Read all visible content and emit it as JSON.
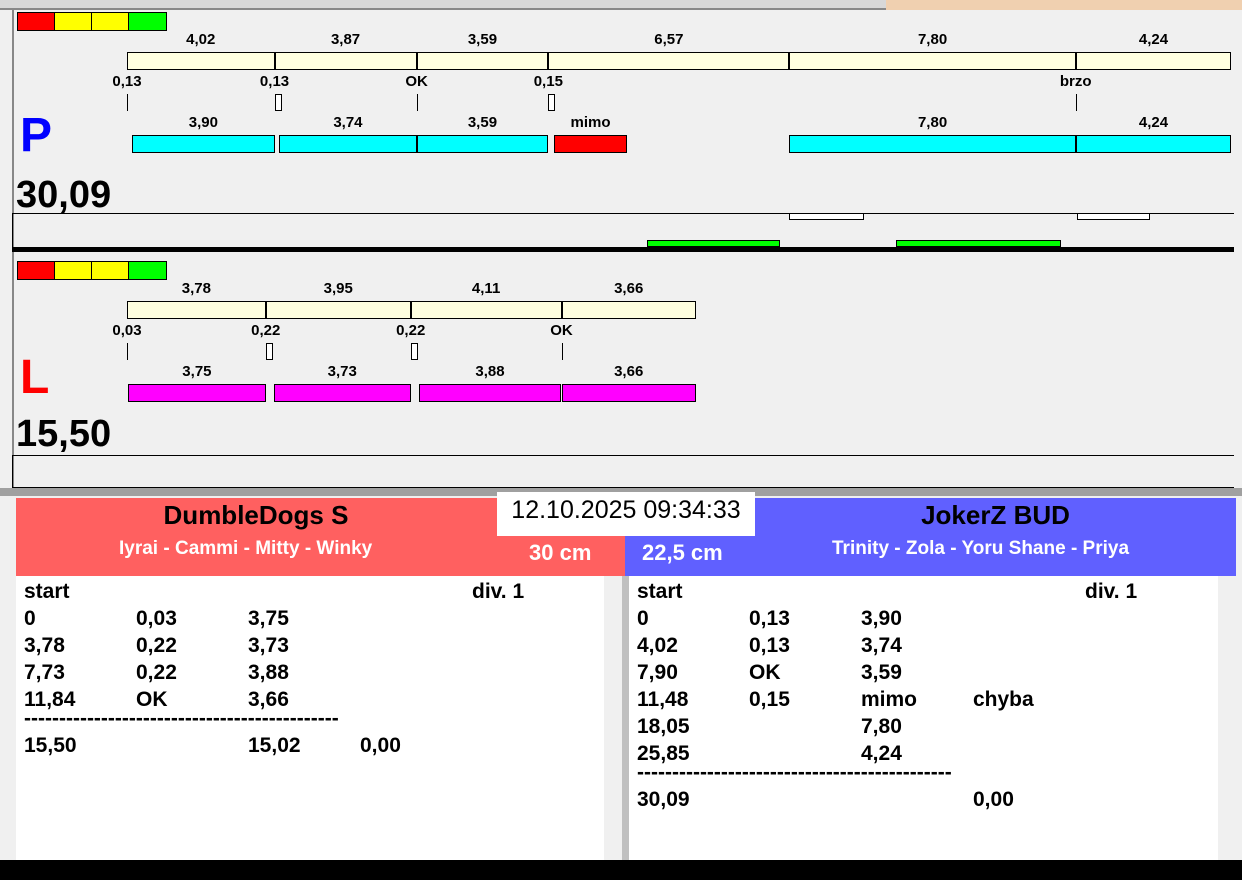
{
  "colors": {
    "legend": [
      "#ff0000",
      "#ffff00",
      "#ffff00",
      "#00ff00"
    ],
    "top_bar": "#ffffe0",
    "p_run": "#00ffff",
    "l_run": "#ff00ff",
    "miss": "#ff0000",
    "left_team": "#ff6060",
    "right_team": "#6060ff",
    "green": "#00ff00"
  },
  "p": {
    "letter": "P",
    "total": "30,09",
    "splits": [
      {
        "label": "4,02",
        "v": 4.02
      },
      {
        "label": "3,87",
        "v": 3.87
      },
      {
        "label": "3,59",
        "v": 3.59
      },
      {
        "label": "6,57",
        "v": 6.57
      },
      {
        "label": "7,80",
        "v": 7.8
      },
      {
        "label": "4,24",
        "v": 4.24
      }
    ],
    "reactions": [
      "0,13",
      "0,13",
      "OK",
      "0,15",
      "",
      "brzo"
    ],
    "runs": [
      {
        "label": "3,90",
        "start": 0.13,
        "v": 3.9,
        "type": "run"
      },
      {
        "label": "3,74",
        "start": 4.15,
        "v": 3.74,
        "type": "run"
      },
      {
        "label": "3,59",
        "start": 7.89,
        "v": 3.59,
        "type": "run"
      },
      {
        "label": "mimo",
        "start": 11.63,
        "v": 2.0,
        "type": "miss"
      },
      {
        "label": "7,80",
        "start": 18.05,
        "v": 7.8,
        "type": "run"
      },
      {
        "label": "4,24",
        "start": 25.85,
        "v": 4.24,
        "type": "run"
      }
    ]
  },
  "l": {
    "letter": "L",
    "total": "15,50",
    "splits": [
      {
        "label": "3,78",
        "v": 3.78
      },
      {
        "label": "3,95",
        "v": 3.95
      },
      {
        "label": "4,11",
        "v": 4.11
      },
      {
        "label": "3,66",
        "v": 3.66
      }
    ],
    "reactions": [
      "0,03",
      "0,22",
      "0,22",
      "OK"
    ],
    "runs": [
      {
        "label": "3,75",
        "start": 0.03,
        "v": 3.75,
        "type": "run"
      },
      {
        "label": "3,73",
        "start": 4.0,
        "v": 3.73,
        "type": "run"
      },
      {
        "label": "3,88",
        "start": 7.95,
        "v": 3.88,
        "type": "run"
      },
      {
        "label": "3,66",
        "start": 11.84,
        "v": 3.66,
        "type": "run"
      }
    ]
  },
  "datetime": "12.10.2025 09:34:33",
  "left_team": {
    "name": "DumbleDogs S",
    "members": "Iyrai - Cammi - Mitty - Winky",
    "distance": "30 cm",
    "header": [
      "start",
      "div.  1"
    ],
    "rows": [
      [
        "0",
        "0,03",
        "3,75",
        ""
      ],
      [
        "3,78",
        "0,22",
        "3,73",
        ""
      ],
      [
        "7,73",
        "0,22",
        "3,88",
        ""
      ],
      [
        "11,84",
        "OK",
        "3,66",
        ""
      ]
    ],
    "divider": "---------------------------------------------",
    "total": [
      "15,50",
      "",
      "15,02",
      "0,00"
    ]
  },
  "right_team": {
    "name": "JokerZ BUD",
    "members": "Trinity - Zola - Yoru Shane - Priya",
    "distance": "22,5 cm",
    "header": [
      "start",
      "div.  1"
    ],
    "rows": [
      [
        "0",
        "0,13",
        "3,90",
        ""
      ],
      [
        "4,02",
        "0,13",
        "3,74",
        ""
      ],
      [
        "7,90",
        "OK",
        "3,59",
        ""
      ],
      [
        "11,48",
        "0,15",
        "mimo",
        "chyba"
      ],
      [
        "18,05",
        "",
        "7,80",
        ""
      ],
      [
        "25,85",
        "",
        "4,24",
        ""
      ]
    ],
    "divider": "---------------------------------------------",
    "total": [
      "30,09",
      "",
      "",
      "0,00"
    ]
  }
}
